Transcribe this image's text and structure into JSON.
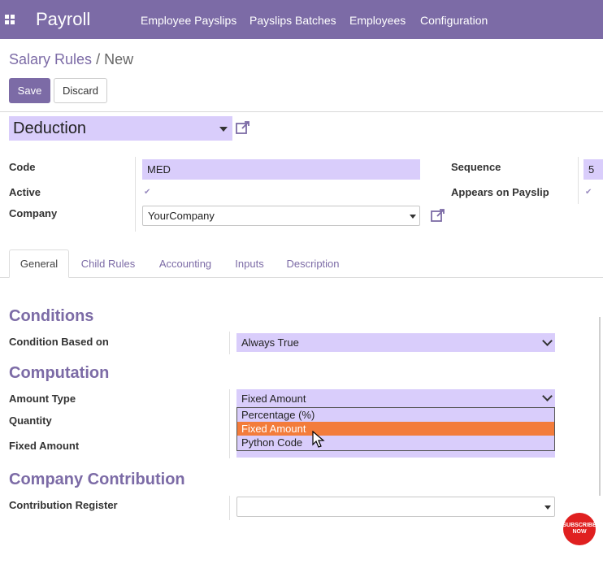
{
  "navbar": {
    "app_name": "Payroll",
    "items": [
      "Employee Payslips",
      "Payslips Batches",
      "Employees",
      "Configuration"
    ]
  },
  "breadcrumb": {
    "parent": "Salary Rules",
    "separator": "/",
    "current": "New"
  },
  "buttons": {
    "save": "Save",
    "discard": "Discard"
  },
  "form": {
    "category_value": "Deduction",
    "code_label": "Code",
    "code_value": "MED",
    "active_label": "Active",
    "active_checked": true,
    "company_label": "Company",
    "company_value": "YourCompany",
    "sequence_label": "Sequence",
    "sequence_value": "5",
    "appears_label": "Appears on Payslip",
    "appears_checked": true
  },
  "tabs": [
    "General",
    "Child Rules",
    "Accounting",
    "Inputs",
    "Description"
  ],
  "active_tab": "General",
  "general": {
    "conditions_title": "Conditions",
    "condition_based_label": "Condition Based on",
    "condition_based_value": "Always True",
    "computation_title": "Computation",
    "amount_type_label": "Amount Type",
    "amount_type_value": "Fixed Amount",
    "quantity_label": "Quantity",
    "fixed_amount_label": "Fixed Amount",
    "contribution_title": "Company Contribution",
    "contribution_register_label": "Contribution Register",
    "contribution_register_value": ""
  },
  "amount_type_options": [
    "Percentage (%)",
    "Fixed Amount",
    "Python Code"
  ],
  "highlighted_option": "Fixed Amount",
  "badge": {
    "line1": "SUBSCRIBE",
    "line2": "NOW"
  },
  "colors": {
    "brand": "#7c6ba6",
    "field": "#d9cdfb",
    "highlight": "#f37c3b",
    "badge": "#e02020"
  }
}
